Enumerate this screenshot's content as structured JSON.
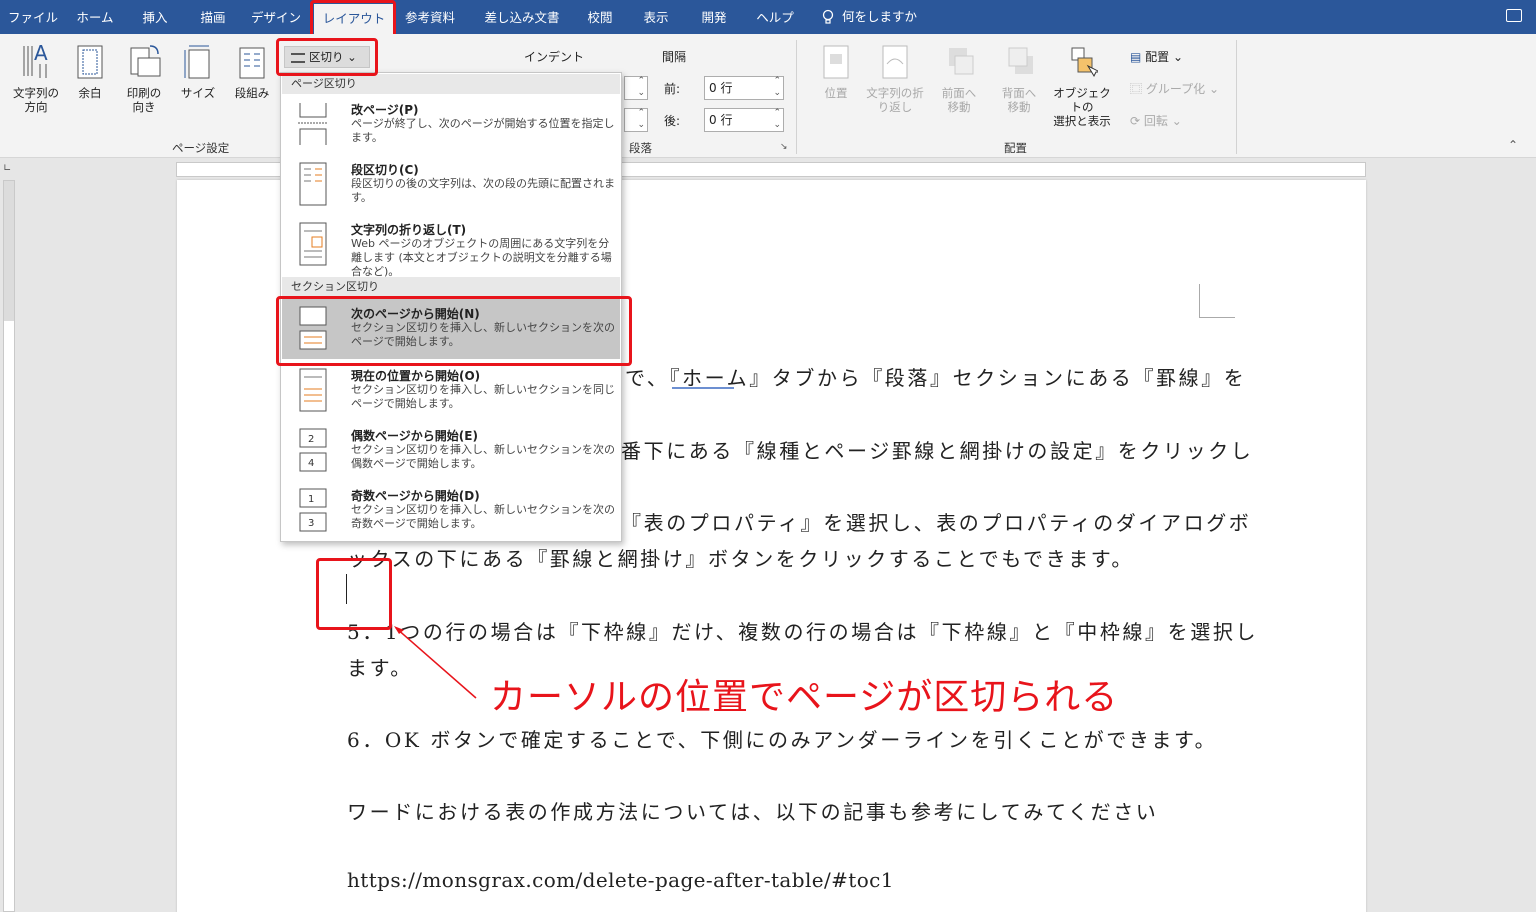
{
  "tabs": [
    "ファイル",
    "ホーム",
    "挿入",
    "描画",
    "デザイン",
    "レイアウト",
    "参考資料",
    "差し込み文書",
    "校閲",
    "表示",
    "開発",
    "ヘルプ"
  ],
  "tell_me": "何をしますか",
  "ribbon": {
    "text_direction": "文字列の\n方向",
    "margins": "余白",
    "orientation": "印刷の\n向き",
    "size": "サイズ",
    "columns": "段組み",
    "breaks": "区切り",
    "page_setup": "ページ設定",
    "indent": "インデント",
    "spacing": "間隔",
    "before_label": "前:",
    "after_label": "後:",
    "before_value": "0 行",
    "after_value": "0 行",
    "paragraph": "段落",
    "position": "位置",
    "wrap_text": "文字列の折\nり返し",
    "bring_forward": "前面へ\n移動",
    "send_backward": "背面へ\n移動",
    "selection_pane": "オブジェクトの\n選択と表示",
    "align": "配置",
    "group": "グループ化",
    "rotate": "回転",
    "arrange": "配置"
  },
  "menu": {
    "page_breaks_header": "ページ区切り",
    "section_breaks_header": "セクション区切り",
    "items": [
      {
        "title": "改ページ(P)",
        "desc": "ページが終了し、次のページが開始する位置を指定します。"
      },
      {
        "title": "段区切り(C)",
        "desc": "段区切りの後の文字列は、次の段の先頭に配置されます。"
      },
      {
        "title": "文字列の折り返し(T)",
        "desc": "Web ページのオブジェクトの周囲にある文字列を分離します (本文とオブジェクトの説明文を分離する場合など)。"
      },
      {
        "title": "次のページから開始(N)",
        "desc": "セクション区切りを挿入し、新しいセクションを次のページで開始します。"
      },
      {
        "title": "現在の位置から開始(O)",
        "desc": "セクション区切りを挿入し、新しいセクションを同じページで開始します。"
      },
      {
        "title": "偶数ページから開始(E)",
        "desc": "セクション区切りを挿入し、新しいセクションを次の偶数ページで開始します。"
      },
      {
        "title": "奇数ページから開始(D)",
        "desc": "セクション区切りを挿入し、新しいセクションを次の奇数ページで開始します。"
      }
    ]
  },
  "doc": {
    "line1": "で、『ホーム』タブから『段落』セクションにある『罫線』を",
    "line2": "番下にある『線種とページ罫線と網掛けの設定』をクリックし",
    "line3": "『表のプロパティ』を選択し、表のプロパティのダイアログボ",
    "line4": "ックスの下にある『罫線と網掛け』ボタンをクリックすることでもできます。",
    "line5": "5．1つの行の場合は『下枠線』だけ、複数の行の場合は『下枠線』と『中枠線』を選択し",
    "line6": "ます。",
    "line7": "6．OK ボタンで確定することで、下側にのみアンダーラインを引くことができます。",
    "line8": "ワードにおける表の作成方法については、以下の記事も参考にしてみてください",
    "line9": "https://monsgrax.com/delete-page-after-table/#toc1"
  },
  "annotation": "カーソルの位置でページが区切られる",
  "colors": {
    "accent": "#2b579a",
    "highlight": "#e8141b"
  }
}
